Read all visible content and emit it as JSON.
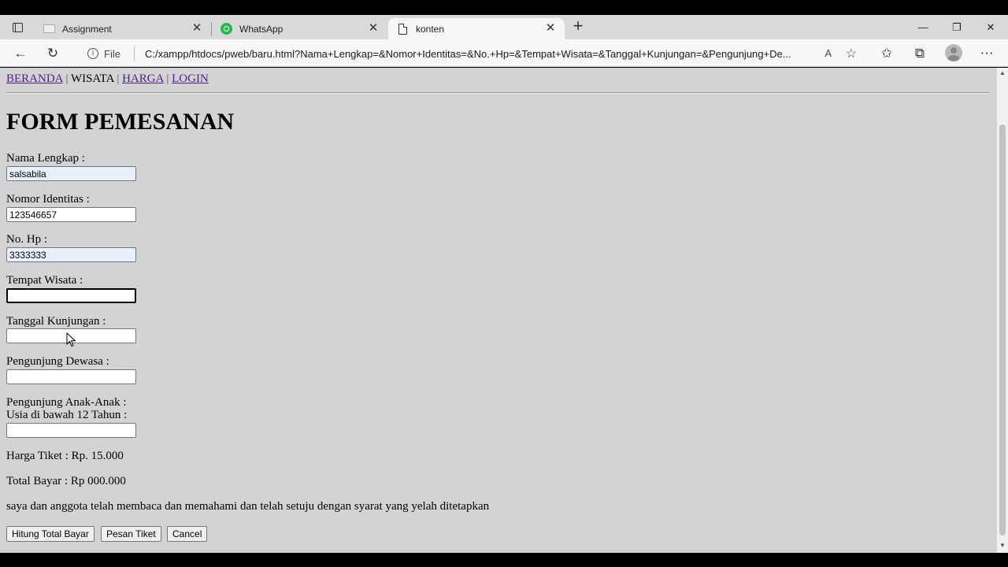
{
  "browser": {
    "tabs": [
      {
        "title": "Assignment",
        "favicon": "assignment-icon",
        "active": false
      },
      {
        "title": "WhatsApp",
        "favicon": "whatsapp-icon",
        "active": false
      },
      {
        "title": "konten",
        "favicon": "document-icon",
        "active": true
      }
    ],
    "address": {
      "scheme_label": "File",
      "url": "C:/xampp/htdocs/pweb/baru.html?Nama+Lengkap=&Nomor+Identitas=&No.+Hp=&Tempat+Wisata=&Tanggal+Kunjungan=&Pengunjung+De..."
    }
  },
  "nav": {
    "items": [
      {
        "label": "BERANDA",
        "link": true
      },
      {
        "label": "WISATA",
        "link": false
      },
      {
        "label": "HARGA",
        "link": true
      },
      {
        "label": "LOGIN",
        "link": true
      }
    ],
    "separator": "|"
  },
  "form": {
    "title": "FORM PEMESANAN",
    "fields": {
      "nama": {
        "label": "Nama Lengkap :",
        "value": "salsabila"
      },
      "identitas": {
        "label": "Nomor Identitas :",
        "value": "123546657"
      },
      "hp": {
        "label": "No. Hp :",
        "value": "3333333"
      },
      "tempat": {
        "label": "Tempat Wisata :",
        "value": ""
      },
      "tanggal": {
        "label": "Tanggal Kunjungan :",
        "value": ""
      },
      "dewasa": {
        "label": "Pengunjung Dewasa :",
        "value": ""
      },
      "anak": {
        "label_line1": "Pengunjung Anak-Anak :",
        "label_line2": "Usia di bawah 12 Tahun :",
        "value": ""
      }
    },
    "harga_tiket": "Harga Tiket : Rp. 15.000",
    "total_bayar": "Total Bayar : Rp 000.000",
    "agreement": "saya dan anggota telah membaca dan memahami dan telah setuju dengan syarat yang yelah ditetapkan",
    "buttons": {
      "hitung": "Hitung Total Bayar",
      "pesan": "Pesan Tiket",
      "cancel": "Cancel"
    }
  },
  "colors": {
    "page_background": "#d3d3d3",
    "link": "#551a8b",
    "autofill": "#e8f0fe"
  }
}
